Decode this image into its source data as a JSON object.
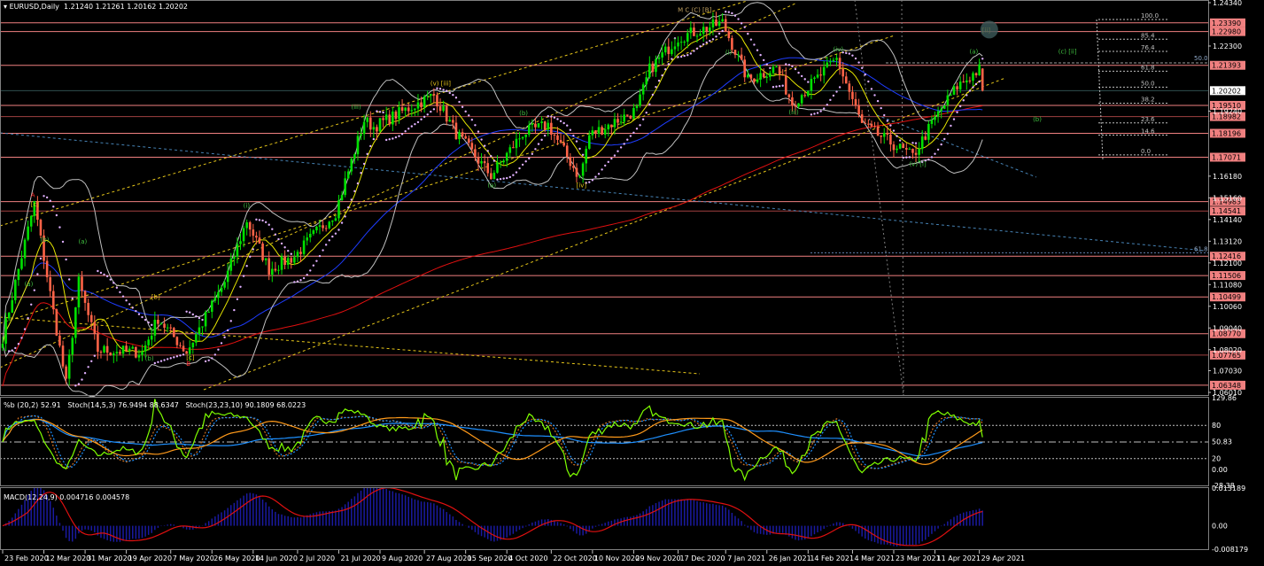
{
  "header": {
    "symbol": "EURUSD,Daily",
    "open": "1.21240",
    "high": "1.21261",
    "low": "1.20162",
    "close": "1.20202"
  },
  "indicator1": {
    "title": "%b (20,2) 52.91   Stoch(14,5,3) 76.9494 88.6347   Stoch(23,23,10) 90.1809 68.0223",
    "axis": [
      "129.86",
      "80",
      "50.83",
      "20",
      "0.00",
      "-28.38"
    ],
    "levels": [
      80,
      50,
      20
    ],
    "range": [
      -28.38,
      129.86
    ]
  },
  "indicator2": {
    "title": "MACD(12,24,9) 0.004716 0.004578",
    "axis": [
      "0.013189",
      "0.00",
      "-0.008179"
    ],
    "range": [
      -0.008179,
      0.013189
    ]
  },
  "colors": {
    "bull": "#00e000",
    "bear": "#ff6347",
    "level": "#f08080",
    "level_dark": "#a04040",
    "ma_fast": "#1e3cff",
    "ma_slow": "#e01010",
    "bands": "#c0c0c0",
    "sar": "#e0b0ff",
    "channel": "#e6c619",
    "percent_b": "#7fff00",
    "stoch_slow": "#ff9a1a",
    "stoch_blue": "#1e90ff",
    "macd_hist": "#1a1aa0",
    "macd_signal": "#e01010"
  },
  "chart_data": {
    "type": "candlestick",
    "title": "EURUSD,Daily",
    "ylim": [
      1.0601,
      1.2434
    ],
    "price_ticks": [
      "1.24340",
      "1.22300",
      "1.19240",
      "1.16180",
      "1.15160",
      "1.14140",
      "1.13120",
      "1.12100",
      "1.11080",
      "1.10060",
      "1.09040",
      "1.08020",
      "1.07030",
      "1.06010"
    ],
    "current_price": "1.20202",
    "levels": [
      {
        "price": "1.23390",
        "dark": false
      },
      {
        "price": "1.22980",
        "dark": false
      },
      {
        "price": "1.21393",
        "dark": false
      },
      {
        "price": "1.19510",
        "dark": false
      },
      {
        "price": "1.18982",
        "dark": true
      },
      {
        "price": "1.18196",
        "dark": false
      },
      {
        "price": "1.17071",
        "dark": false
      },
      {
        "price": "1.14983",
        "dark": false
      },
      {
        "price": "1.14541",
        "dark": true
      },
      {
        "price": "1.12416",
        "dark": false
      },
      {
        "price": "1.11506",
        "dark": false
      },
      {
        "price": "1.10499",
        "dark": false
      },
      {
        "price": "1.08770",
        "dark": false
      },
      {
        "price": "1.07765",
        "dark": true
      },
      {
        "price": "1.06348",
        "dark": false
      }
    ],
    "fib": {
      "high": 1.2355,
      "low": 1.1718,
      "levels": [
        "100.0",
        "85.4",
        "76.4",
        "61.8",
        "50.0",
        "38.2",
        "23.6",
        "14.6",
        "0.0"
      ]
    },
    "date_ticks": [
      "23 Feb 2020",
      "12 Mar 2020",
      "31 Mar 2020",
      "19 Apr 2020",
      "7 May 2020",
      "26 May 2020",
      "14 Jun 2020",
      "2 Jul 2020",
      "21 Jul 2020",
      "9 Aug 2020",
      "27 Aug 2020",
      "15 Sep 2020",
      "4 Oct 2020",
      "22 Oct 2020",
      "10 Nov 2020",
      "29 Nov 2020",
      "17 Dec 2020",
      "7 Jan 2021",
      "26 Jan 2021",
      "14 Feb 2021",
      "4 Mar 2021",
      "23 Mar 2021",
      "11 Apr 2021",
      "29 Apr 2021"
    ],
    "price_path": [
      [
        "2020-02-24",
        1.086
      ],
      [
        "2020-03-02",
        1.118
      ],
      [
        "2020-03-09",
        1.149
      ],
      [
        "2020-03-23",
        1.064
      ],
      [
        "2020-03-27",
        1.112
      ],
      [
        "2020-04-06",
        1.08
      ],
      [
        "2020-04-24",
        1.079
      ],
      [
        "2020-05-01",
        1.095
      ],
      [
        "2020-05-14",
        1.079
      ],
      [
        "2020-06-01",
        1.112
      ],
      [
        "2020-06-10",
        1.141
      ],
      [
        "2020-06-19",
        1.118
      ],
      [
        "2020-07-01",
        1.124
      ],
      [
        "2020-07-09",
        1.134
      ],
      [
        "2020-07-20",
        1.145
      ],
      [
        "2020-07-31",
        1.188
      ],
      [
        "2020-08-05",
        1.185
      ],
      [
        "2020-08-19",
        1.193
      ],
      [
        "2020-09-01",
        1.2
      ],
      [
        "2020-09-10",
        1.182
      ],
      [
        "2020-09-25",
        1.162
      ],
      [
        "2020-10-09",
        1.182
      ],
      [
        "2020-10-21",
        1.186
      ],
      [
        "2020-11-04",
        1.161
      ],
      [
        "2020-11-09",
        1.181
      ],
      [
        "2020-11-30",
        1.193
      ],
      [
        "2020-12-04",
        1.212
      ],
      [
        "2020-12-17",
        1.227
      ],
      [
        "2021-01-06",
        1.234
      ],
      [
        "2021-01-18",
        1.207
      ],
      [
        "2021-01-29",
        1.213
      ],
      [
        "2021-02-05",
        1.196
      ],
      [
        "2021-02-25",
        1.217
      ],
      [
        "2021-03-09",
        1.186
      ],
      [
        "2021-03-31",
        1.171
      ],
      [
        "2021-04-09",
        1.189
      ],
      [
        "2021-04-20",
        1.204
      ],
      [
        "2021-04-29",
        1.212
      ],
      [
        "2021-04-30",
        1.202
      ]
    ],
    "wave_labels": [
      {
        "text": "A",
        "date": "2020-03-09",
        "price": 1.152,
        "color": "#ff3030"
      },
      {
        "text": "[c]",
        "date": "2020-03-09",
        "price": 1.1475,
        "color": "#e6c619"
      },
      {
        "text": "(b)",
        "date": "2020-03-12",
        "price": 1.131,
        "color": "#40c040"
      },
      {
        "text": "(a)",
        "date": "2020-03-05",
        "price": 1.11,
        "color": "#40c040"
      },
      {
        "text": "(a)",
        "date": "2020-03-30",
        "price": 1.13,
        "color": "#40c040"
      },
      {
        "text": "(b)",
        "date": "2020-04-28",
        "price": 1.075,
        "color": "#40c040"
      },
      {
        "text": "[b]",
        "date": "2020-04-30",
        "price": 1.104,
        "color": "#e6c619"
      },
      {
        "text": "[c]",
        "date": "2020-05-15",
        "price": 1.0755,
        "color": "#e6c619"
      },
      {
        "text": "B",
        "date": "2020-05-15",
        "price": 1.0725,
        "color": "#ff3030"
      },
      {
        "text": "(i)",
        "date": "2020-06-10",
        "price": 1.147,
        "color": "#40c040"
      },
      {
        "text": "(iii)",
        "date": "2020-07-28",
        "price": 1.1935,
        "color": "#40c040"
      },
      {
        "text": "(v) [iii]",
        "date": "2020-09-01",
        "price": 1.2045,
        "color": "#e6c619"
      },
      {
        "text": "(a)",
        "date": "2020-09-25",
        "price": 1.1565,
        "color": "#40c040"
      },
      {
        "text": "(b)",
        "date": "2020-10-09",
        "price": 1.1905,
        "color": "#40c040"
      },
      {
        "text": "[iv]",
        "date": "2020-11-04",
        "price": 1.1565,
        "color": "#e6c619"
      },
      {
        "text": "M C (C) [B]",
        "date": "2020-12-20",
        "price": 1.239,
        "color": "#c0a060"
      },
      {
        "text": "(i)",
        "date": "2021-01-08",
        "price": 1.219,
        "color": "#40c040"
      },
      {
        "text": "(iii)",
        "date": "2021-02-05",
        "price": 1.191,
        "color": "#40c040"
      },
      {
        "text": "(iv)",
        "date": "2021-02-25",
        "price": 1.2205,
        "color": "#40c040"
      },
      {
        "text": "(v) [i]",
        "date": "2021-03-31",
        "price": 1.1665,
        "color": "#40c040"
      },
      {
        "text": "(a)",
        "date": "2021-04-27",
        "price": 1.2195,
        "color": "#40c040"
      },
      {
        "text": "[ii]",
        "date": "2021-05-03",
        "price": 1.2295,
        "color": "#e6c619"
      },
      {
        "text": "(c) [ii]",
        "date": "2021-06-04",
        "price": 1.2195,
        "color": "#40c040"
      },
      {
        "text": "(b)",
        "date": "2021-05-25",
        "price": 1.1875,
        "color": "#40c040"
      }
    ],
    "right_labels": [
      "50.0",
      "61.8"
    ]
  }
}
